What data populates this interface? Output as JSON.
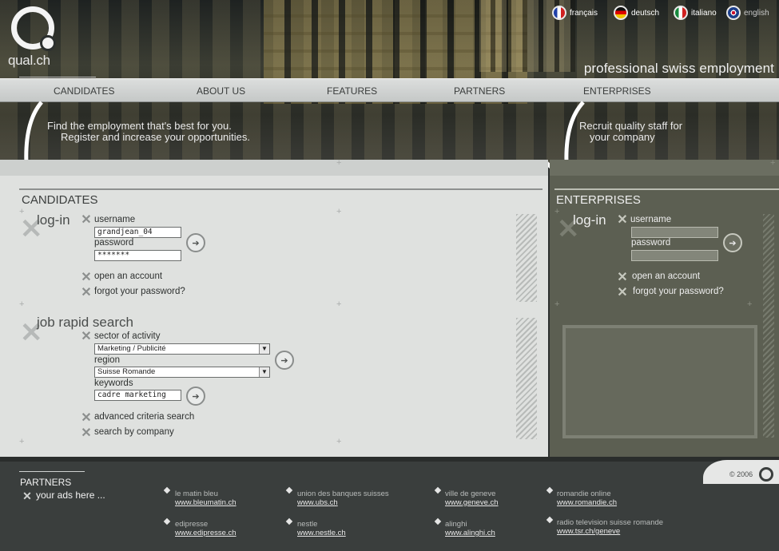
{
  "brand": {
    "logo_text": "qual.ch",
    "tagline": "professional swiss employment"
  },
  "languages": [
    {
      "label": "français",
      "icon": "flag-france-icon"
    },
    {
      "label": "deutsch",
      "icon": "flag-germany-icon"
    },
    {
      "label": "italiano",
      "icon": "flag-italy-icon"
    },
    {
      "label": "english",
      "icon": "flag-uk-icon"
    }
  ],
  "nav": [
    "CANDIDATES",
    "ABOUT US",
    "FEATURES",
    "PARTNERS",
    "ENTERPRISES"
  ],
  "hero": {
    "candidates_line1": "Find the employment that's best for you.",
    "candidates_line2": "Register and increase your opportunities.",
    "enterprises_line1": "Recruit quality staff for",
    "enterprises_line2": "your company"
  },
  "candidates": {
    "title": "CANDIDATES",
    "login": {
      "heading": "log-in",
      "username_label": "username",
      "username_value": "grandjean_04",
      "password_label": "password",
      "password_value": "*******"
    },
    "links": [
      "open an account",
      "forgot your password?"
    ],
    "search": {
      "heading": "job rapid search",
      "sector_label": "sector of activity",
      "sector_value": "Marketing / Publicité",
      "region_label": "region",
      "region_value": "Suisse Romande",
      "keywords_label": "keywords",
      "keywords_value": "cadre marketing",
      "links": [
        "advanced criteria search",
        "search by company"
      ]
    }
  },
  "enterprises": {
    "title": "ENTERPRISES",
    "login": {
      "heading": "log-in",
      "username_label": "username",
      "username_value": "",
      "password_label": "password",
      "password_value": ""
    },
    "links": [
      "open an account",
      "forgot your password?"
    ]
  },
  "footer": {
    "partners_title": "PARTNERS",
    "ads_text": "your ads here ...",
    "copyright": "© 2006",
    "partners": [
      {
        "name": "le matin bleu",
        "url": "www.bleumatin.ch"
      },
      {
        "name": "union des banques suisses",
        "url": "www.ubs.ch"
      },
      {
        "name": "ville de geneve",
        "url": "www.geneve.ch"
      },
      {
        "name": "romandie online",
        "url": "www.romandie.ch"
      },
      {
        "name": "edipresse",
        "url": "www.edipresse.ch"
      },
      {
        "name": "nestle",
        "url": "www.nestle.ch"
      },
      {
        "name": "alinghi",
        "url": "www.alinghi.ch"
      },
      {
        "name": "radio television suisse romande",
        "url": "www.tsr.ch/geneve"
      }
    ]
  },
  "colors": {
    "candidate_panel": "#dfe1df",
    "enterprise_panel": "#5c5f52",
    "footer": "#3a3e3d"
  }
}
